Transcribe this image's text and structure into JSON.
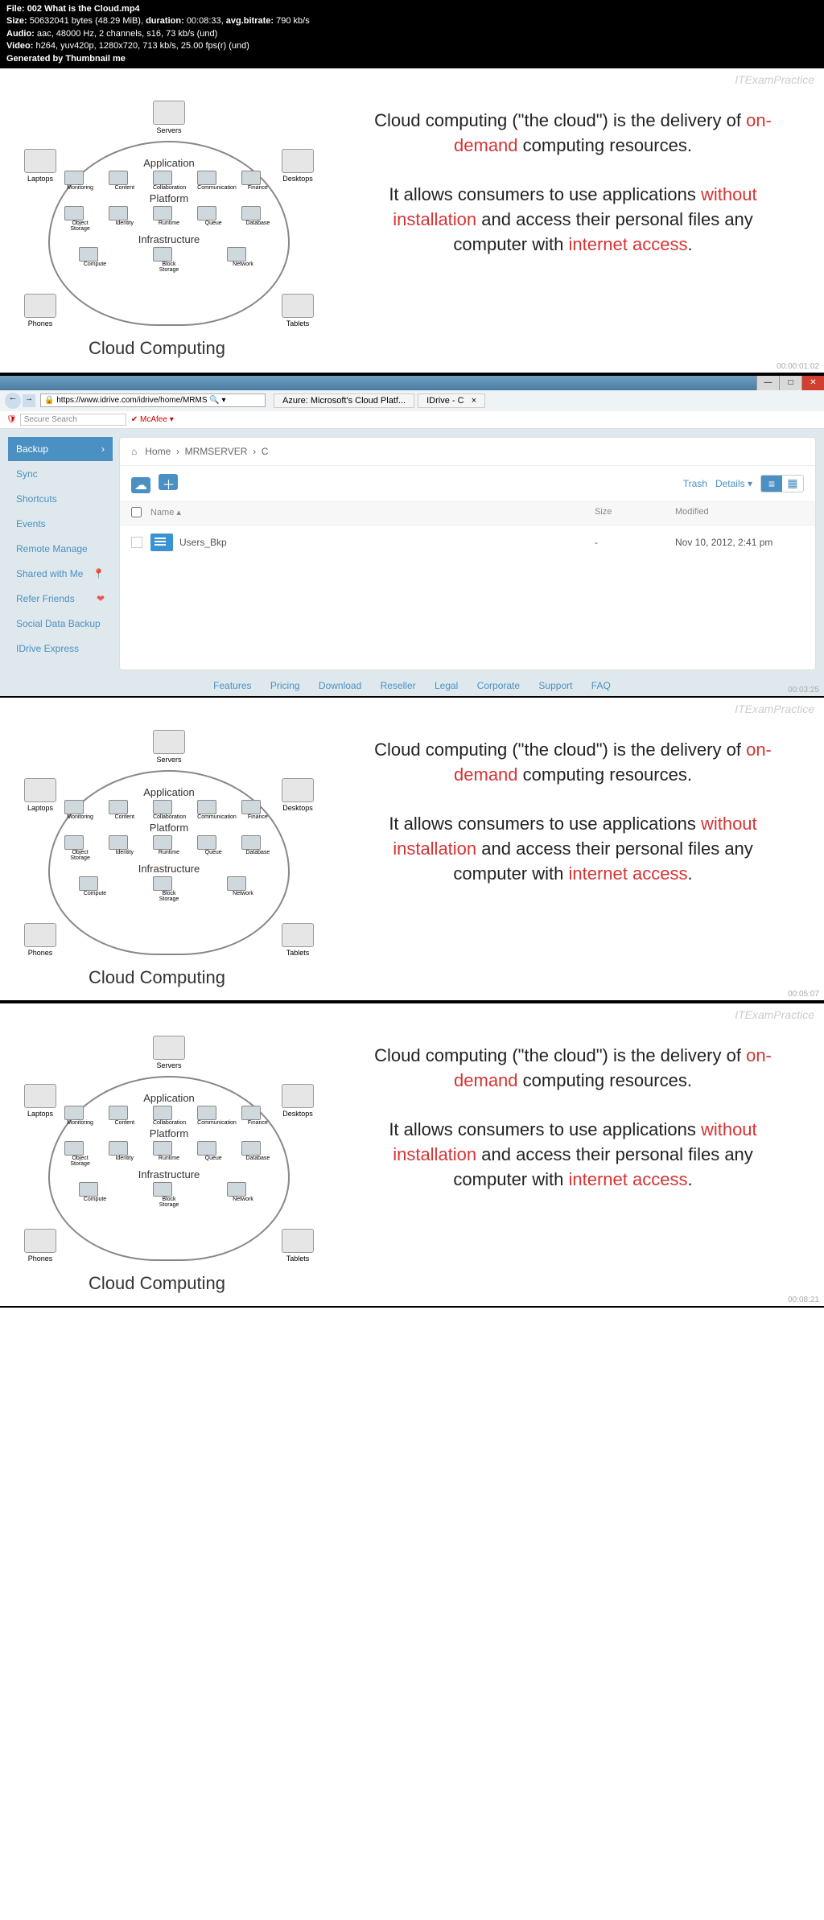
{
  "header": {
    "file_label": "File:",
    "file_name": "002 What is the Cloud.mp4",
    "size_label": "Size:",
    "size_bytes": "50632041 bytes (48.29 MiB),",
    "duration_label": "duration:",
    "duration": "00:08:33,",
    "avg_bitrate_label": "avg.bitrate:",
    "avg_bitrate": "790 kb/s",
    "audio_label": "Audio:",
    "audio": "aac, 48000 Hz, 2 channels, s16, 73 kb/s (und)",
    "video_label": "Video:",
    "video": "h264, yuv420p, 1280x720, 713 kb/s, 25.00 fps(r) (und)",
    "generated": "Generated by Thumbnail me"
  },
  "brand": "ITExamPractice",
  "slide_text": {
    "p1": "Cloud computing (\"the cloud\") is the delivery of ",
    "p1_hl": "on-demand",
    "p1_end": " computing resources.",
    "p2": "It allows consumers to use applications ",
    "p2_hl": "without installation",
    "p2_mid": " and access their personal files any computer with ",
    "p2_hl2": "internet access",
    "p2_end": "."
  },
  "cloud": {
    "title": "Cloud Computing",
    "devices": {
      "servers": "Servers",
      "laptops": "Laptops",
      "desktops": "Desktops",
      "phones": "Phones",
      "tablets": "Tablets"
    },
    "layers": {
      "application": "Application",
      "platform": "Platform",
      "infrastructure": "Infrastructure"
    },
    "icons": {
      "monitoring": "Monitoring",
      "content": "Content",
      "collaboration": "Collaboration",
      "communication": "Communication",
      "finance": "Finance",
      "object_storage": "Object Storage",
      "identity": "Identity",
      "runtime": "Runtime",
      "queue": "Queue",
      "database": "Database",
      "compute": "Compute",
      "block_storage": "Block Storage",
      "network": "Network"
    }
  },
  "timestamps": {
    "t1": "00:00:01:02",
    "t2": "00:03:25",
    "t3": "00:05:07",
    "t4": "00:08:21"
  },
  "browser": {
    "url": "https://www.idrive.com/idrive/home/MRMS",
    "tabs": {
      "azure": "Azure: Microsoft's Cloud Platf...",
      "idrive": "IDrive - C"
    },
    "secure": "Secure Search",
    "mcafee": "McAfee",
    "breadcrumb": {
      "home": "Home",
      "srv": "MRMSERVER",
      "c": "C"
    },
    "sidebar": {
      "backup": "Backup",
      "sync": "Sync",
      "shortcuts": "Shortcuts",
      "events": "Events",
      "remote": "Remote Manage",
      "shared": "Shared with Me",
      "refer": "Refer Friends",
      "social": "Social Data Backup",
      "express": "IDrive Express"
    },
    "toolbar": {
      "trash": "Trash",
      "details": "Details"
    },
    "thead": {
      "name": "Name",
      "size": "Size",
      "modified": "Modified"
    },
    "row": {
      "name": "Users_Bkp",
      "size": "-",
      "modified": "Nov 10, 2012, 2:41 pm"
    },
    "footer": {
      "features": "Features",
      "pricing": "Pricing",
      "download": "Download",
      "reseller": "Reseller",
      "legal": "Legal",
      "corporate": "Corporate",
      "support": "Support",
      "faq": "FAQ"
    }
  }
}
